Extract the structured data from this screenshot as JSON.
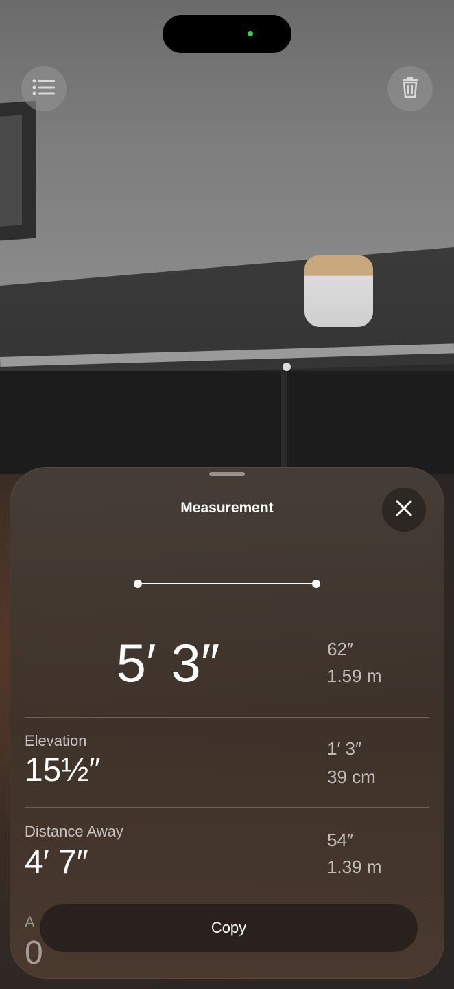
{
  "colors": {
    "status_indicator": "#2fd158",
    "sheet_bg": "#463e37",
    "text_primary": "#ffffff",
    "text_secondary": "#ebebeb"
  },
  "toolbar": {
    "list_icon": "list-icon",
    "delete_icon": "trash-icon"
  },
  "sheet": {
    "title": "Measurement",
    "close_icon": "close-icon",
    "length_primary": "5′ 3″",
    "length_alt_1": "62″",
    "length_alt_2": "1.59 m",
    "rows": [
      {
        "label": "Elevation",
        "value": "15½″",
        "alt_1": "1′ 3″",
        "alt_2": "39 cm"
      },
      {
        "label": "Distance Away",
        "value": "4′ 7″",
        "alt_1": "54″",
        "alt_2": "1.39 m"
      }
    ],
    "partial_row": {
      "label": "A",
      "value": "0"
    },
    "copy_label": "Copy"
  }
}
